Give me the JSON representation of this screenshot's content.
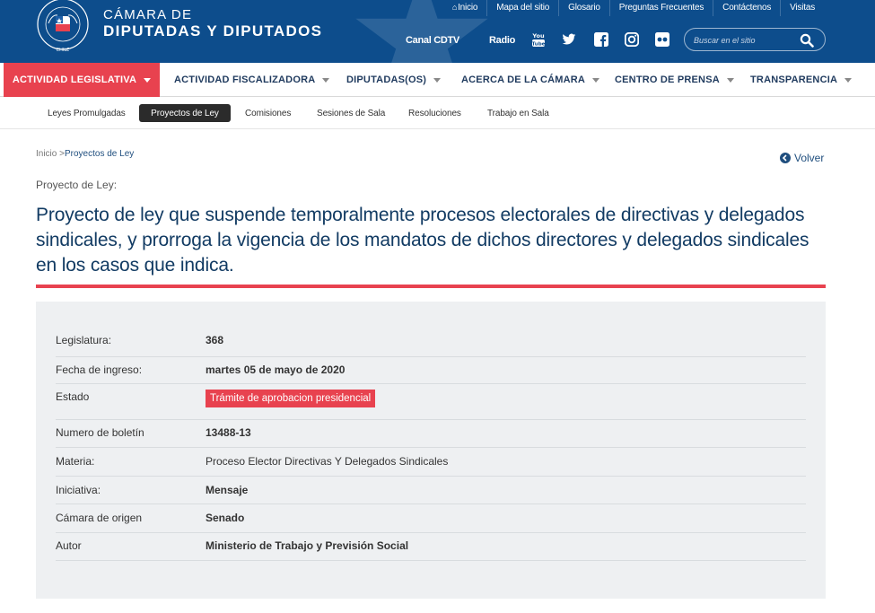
{
  "header": {
    "logo_line1": "CÁMARA DE",
    "logo_line2": "DIPUTADAS Y DIPUTADOS",
    "seal_text": "CÁMARA DE DIPUTADOS DE CHILE",
    "top_links": [
      "Inicio",
      "Mapa del sitio",
      "Glosario",
      "Preguntas Frecuentes",
      "Contáctenos",
      "Visitas"
    ],
    "media": {
      "canal": "Canal CDTV",
      "radio": "Radio"
    },
    "social_icons": [
      "youtube-icon",
      "twitter-icon",
      "facebook-icon",
      "instagram-icon",
      "flickr-icon"
    ],
    "search": {
      "placeholder": "Buscar en el sitio",
      "value": ""
    }
  },
  "main_nav": [
    {
      "label": "ACTIVIDAD LEGISLATIVA",
      "active": true
    },
    {
      "label": "ACTIVIDAD FISCALIZADORA",
      "active": false
    },
    {
      "label": "DIPUTADAS(OS)",
      "active": false
    },
    {
      "label": "ACERCA DE LA CÁMARA",
      "active": false
    },
    {
      "label": "CENTRO DE PRENSA",
      "active": false
    },
    {
      "label": "TRANSPARENCIA",
      "active": false
    }
  ],
  "sub_nav": [
    {
      "label": "Leyes Promulgadas",
      "active": false
    },
    {
      "label": "Proyectos de Ley",
      "active": true
    },
    {
      "label": "Comisiones",
      "active": false
    },
    {
      "label": "Sesiones de Sala",
      "active": false
    },
    {
      "label": "Resoluciones",
      "active": false
    },
    {
      "label": "Trabajo en Sala",
      "active": false
    }
  ],
  "breadcrumb": {
    "home": "Inicio",
    "separator": ">",
    "current": "Proyectos de Ley"
  },
  "back_label": "Volver",
  "kicker": "Proyecto de Ley:",
  "title": "Proyecto de ley que suspende temporalmente procesos electorales de directivas y delegados sindicales, y prorroga la vigencia de los mandatos de dichos directores y delegados sindicales en los casos que indica.",
  "details": [
    {
      "label": "Legislatura:",
      "value": "368",
      "bold": true
    },
    {
      "label": "Fecha de ingreso:",
      "value": "martes 05 de mayo de 2020",
      "bold": true
    },
    {
      "label": "Estado",
      "value": "Trámite de aprobacion presidencial",
      "badge": true
    },
    {
      "label": "Numero de boletín",
      "value": "13488-13",
      "bold": true
    },
    {
      "label": "Materia:",
      "value": "Proceso Elector Directivas Y Delegados Sindicales",
      "bold": false
    },
    {
      "label": "Iniciativa:",
      "value": "Mensaje",
      "bold": true
    },
    {
      "label": "Cámara de origen",
      "value": "Senado",
      "bold": true
    },
    {
      "label": "Autor",
      "value": "Ministerio de Trabajo y Previsión Social",
      "bold": true
    }
  ],
  "colors": {
    "header_blue": "#0d4d8c",
    "accent_red": "#e8424f",
    "title_blue": "#123b63",
    "panel_gray": "#eef0f2"
  }
}
